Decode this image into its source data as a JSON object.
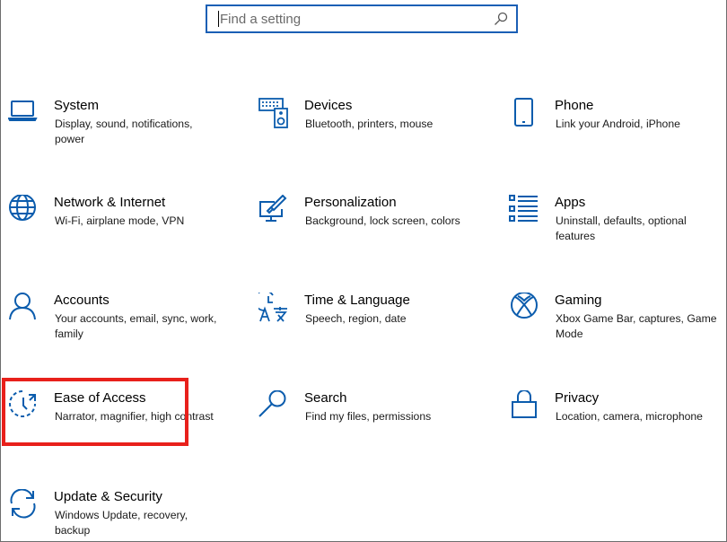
{
  "search": {
    "placeholder": "Find a setting",
    "icon": "search-icon"
  },
  "accent_color": "#0b5cad",
  "highlight_color": "#e8201b",
  "tiles": [
    {
      "title": "System",
      "description": "Display, sound, notifications, power",
      "icon": "laptop-icon"
    },
    {
      "title": "Devices",
      "description": "Bluetooth, printers, mouse",
      "icon": "keyboard-speaker-icon"
    },
    {
      "title": "Phone",
      "description": "Link your Android, iPhone",
      "icon": "phone-icon"
    },
    {
      "title": "Network & Internet",
      "description": "Wi-Fi, airplane mode, VPN",
      "icon": "globe-icon"
    },
    {
      "title": "Personalization",
      "description": "Background, lock screen, colors",
      "icon": "paint-monitor-icon"
    },
    {
      "title": "Apps",
      "description": "Uninstall, defaults, optional features",
      "icon": "apps-list-icon"
    },
    {
      "title": "Accounts",
      "description": "Your accounts, email, sync, work, family",
      "icon": "person-icon"
    },
    {
      "title": "Time & Language",
      "description": "Speech, region, date",
      "icon": "time-language-icon"
    },
    {
      "title": "Gaming",
      "description": "Xbox Game Bar, captures, Game Mode",
      "icon": "xbox-icon"
    },
    {
      "title": "Ease of Access",
      "description": "Narrator, magnifier, high contrast",
      "icon": "ease-of-access-icon"
    },
    {
      "title": "Search",
      "description": "Find my files, permissions",
      "icon": "magnifier-icon"
    },
    {
      "title": "Privacy",
      "description": "Location, camera, microphone",
      "icon": "lock-icon"
    },
    {
      "title": "Update & Security",
      "description": "Windows Update, recovery, backup",
      "icon": "sync-arrows-icon"
    }
  ]
}
